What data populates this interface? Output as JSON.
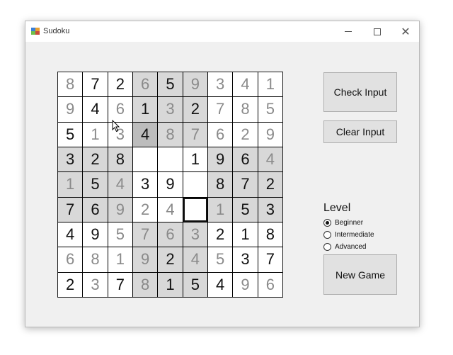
{
  "window": {
    "title": "Sudoku"
  },
  "board": {
    "rows": [
      [
        {
          "v": "8",
          "k": "filled",
          "s": false
        },
        {
          "v": "7",
          "k": "given",
          "s": false
        },
        {
          "v": "2",
          "k": "given",
          "s": false
        },
        {
          "v": "6",
          "k": "filled",
          "s": true
        },
        {
          "v": "5",
          "k": "given",
          "s": true
        },
        {
          "v": "9",
          "k": "filled",
          "s": true
        },
        {
          "v": "3",
          "k": "filled",
          "s": false
        },
        {
          "v": "4",
          "k": "filled",
          "s": false
        },
        {
          "v": "1",
          "k": "filled",
          "s": false
        }
      ],
      [
        {
          "v": "9",
          "k": "filled",
          "s": false
        },
        {
          "v": "4",
          "k": "given",
          "s": false
        },
        {
          "v": "6",
          "k": "filled",
          "s": false
        },
        {
          "v": "1",
          "k": "given",
          "s": true
        },
        {
          "v": "3",
          "k": "filled",
          "s": true
        },
        {
          "v": "2",
          "k": "given",
          "s": true
        },
        {
          "v": "7",
          "k": "filled",
          "s": false
        },
        {
          "v": "8",
          "k": "filled",
          "s": false
        },
        {
          "v": "5",
          "k": "filled",
          "s": false
        }
      ],
      [
        {
          "v": "5",
          "k": "given",
          "s": false
        },
        {
          "v": "1",
          "k": "filled",
          "s": false
        },
        {
          "v": "3",
          "k": "filled",
          "s": false
        },
        {
          "v": "4",
          "k": "given",
          "s": true,
          "hl": true
        },
        {
          "v": "8",
          "k": "filled",
          "s": true
        },
        {
          "v": "7",
          "k": "filled",
          "s": true
        },
        {
          "v": "6",
          "k": "filled",
          "s": false
        },
        {
          "v": "2",
          "k": "filled",
          "s": false
        },
        {
          "v": "9",
          "k": "filled",
          "s": false
        }
      ],
      [
        {
          "v": "3",
          "k": "given",
          "s": true
        },
        {
          "v": "2",
          "k": "given",
          "s": true
        },
        {
          "v": "8",
          "k": "given",
          "s": true
        },
        {
          "v": "",
          "k": "filled",
          "s": false
        },
        {
          "v": "",
          "k": "filled",
          "s": false
        },
        {
          "v": "1",
          "k": "given",
          "s": false
        },
        {
          "v": "9",
          "k": "given",
          "s": true
        },
        {
          "v": "6",
          "k": "given",
          "s": true
        },
        {
          "v": "4",
          "k": "filled",
          "s": true
        }
      ],
      [
        {
          "v": "1",
          "k": "filled",
          "s": true
        },
        {
          "v": "5",
          "k": "given",
          "s": true
        },
        {
          "v": "4",
          "k": "filled",
          "s": true
        },
        {
          "v": "3",
          "k": "given",
          "s": false
        },
        {
          "v": "9",
          "k": "given",
          "s": false
        },
        {
          "v": "",
          "k": "filled",
          "s": false
        },
        {
          "v": "8",
          "k": "given",
          "s": true
        },
        {
          "v": "7",
          "k": "given",
          "s": true
        },
        {
          "v": "2",
          "k": "given",
          "s": true
        }
      ],
      [
        {
          "v": "7",
          "k": "given",
          "s": true
        },
        {
          "v": "6",
          "k": "given",
          "s": true
        },
        {
          "v": "9",
          "k": "filled",
          "s": true
        },
        {
          "v": "2",
          "k": "filled",
          "s": false
        },
        {
          "v": "4",
          "k": "filled",
          "s": false
        },
        {
          "v": "",
          "k": "filled",
          "s": false,
          "sel": true
        },
        {
          "v": "1",
          "k": "filled",
          "s": true
        },
        {
          "v": "5",
          "k": "given",
          "s": true
        },
        {
          "v": "3",
          "k": "given",
          "s": true
        }
      ],
      [
        {
          "v": "4",
          "k": "given",
          "s": false
        },
        {
          "v": "9",
          "k": "given",
          "s": false
        },
        {
          "v": "5",
          "k": "filled",
          "s": false
        },
        {
          "v": "7",
          "k": "filled",
          "s": true
        },
        {
          "v": "6",
          "k": "filled",
          "s": true
        },
        {
          "v": "3",
          "k": "filled",
          "s": true
        },
        {
          "v": "2",
          "k": "given",
          "s": false
        },
        {
          "v": "1",
          "k": "given",
          "s": false
        },
        {
          "v": "8",
          "k": "given",
          "s": false
        }
      ],
      [
        {
          "v": "6",
          "k": "filled",
          "s": false
        },
        {
          "v": "8",
          "k": "filled",
          "s": false
        },
        {
          "v": "1",
          "k": "filled",
          "s": false
        },
        {
          "v": "9",
          "k": "filled",
          "s": true
        },
        {
          "v": "2",
          "k": "given",
          "s": true
        },
        {
          "v": "4",
          "k": "filled",
          "s": true
        },
        {
          "v": "5",
          "k": "filled",
          "s": false
        },
        {
          "v": "3",
          "k": "given",
          "s": false
        },
        {
          "v": "7",
          "k": "given",
          "s": false
        }
      ],
      [
        {
          "v": "2",
          "k": "given",
          "s": false
        },
        {
          "v": "3",
          "k": "filled",
          "s": false
        },
        {
          "v": "7",
          "k": "given",
          "s": false
        },
        {
          "v": "8",
          "k": "filled",
          "s": true
        },
        {
          "v": "1",
          "k": "given",
          "s": true
        },
        {
          "v": "5",
          "k": "given",
          "s": true
        },
        {
          "v": "4",
          "k": "given",
          "s": false
        },
        {
          "v": "9",
          "k": "filled",
          "s": false
        },
        {
          "v": "6",
          "k": "filled",
          "s": false
        }
      ]
    ]
  },
  "buttons": {
    "check": "Check Input",
    "clear": "Clear Input",
    "new_game": "New Game"
  },
  "level": {
    "label": "Level",
    "options": [
      {
        "label": "Beginner",
        "checked": true
      },
      {
        "label": "Intermediate",
        "checked": false
      },
      {
        "label": "Advanced",
        "checked": false
      }
    ]
  },
  "colors": {
    "given_digit": "#111111",
    "filled_digit": "#8a8a8a",
    "box_shade": "#d8d8d8",
    "highlight": "#bcbcbc"
  }
}
